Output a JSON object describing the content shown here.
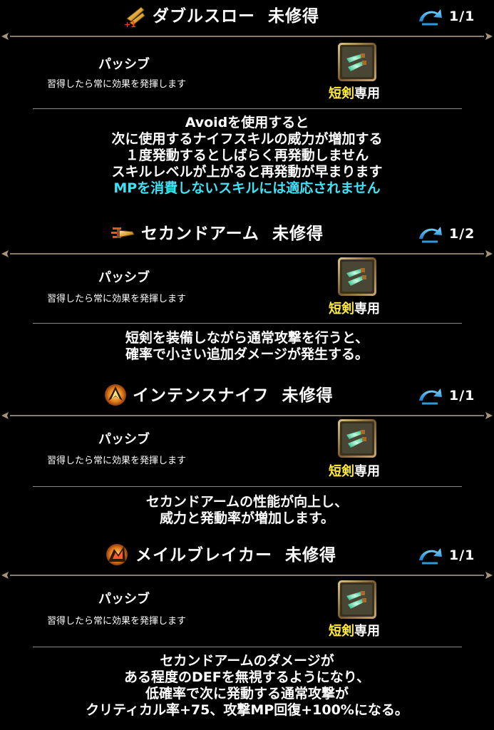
{
  "colors": {
    "background": "#000000",
    "text": "#ffffff",
    "weapon_highlight": "#ffe93a",
    "note_cyan": "#3fe3f6",
    "divider": "#8a7a6a"
  },
  "skills": [
    {
      "icon": "double-throw-icon",
      "name": "ダブルスロー",
      "status": "未修得",
      "level": "1/1",
      "type_label": "パッシブ",
      "type_desc": "習得したら常に効果を発揮します",
      "weapon_prefix": "短剣",
      "weapon_suffix": "専用",
      "desc_lines": [
        "Avoidを使用すると",
        "次に使用するナイフスキルの威力が増加する",
        "１度発動するとしばらく再発動しません",
        "スキルレベルが上がると再発動が早まります"
      ],
      "note": "MPを消費しないスキルには適応されません"
    },
    {
      "icon": "second-arm-icon",
      "name": "セカンドアーム",
      "status": "未修得",
      "level": "1/2",
      "type_label": "パッシブ",
      "type_desc": "習得したら常に効果を発揮します",
      "weapon_prefix": "短剣",
      "weapon_suffix": "専用",
      "desc_lines": [
        "短剣を装備しながら通常攻撃を行うと、",
        "確率で小さい追加ダメージが発生する。"
      ]
    },
    {
      "icon": "intense-knife-icon",
      "name": "インテンスナイフ",
      "status": "未修得",
      "level": "1/1",
      "type_label": "パッシブ",
      "type_desc": "習得したら常に効果を発揮します",
      "weapon_prefix": "短剣",
      "weapon_suffix": "専用",
      "desc_lines": [
        "セカンドアームの性能が向上し、",
        "威力と発動率が増加します。"
      ]
    },
    {
      "icon": "mail-breaker-icon",
      "name": "メイルブレイカー",
      "status": "未修得",
      "level": "1/1",
      "type_label": "パッシブ",
      "type_desc": "習得したら常に効果を発揮します",
      "weapon_prefix": "短剣",
      "weapon_suffix": "専用",
      "desc_lines": [
        "セカンドアームのダメージが",
        "ある程度のDEFを無視するようになり、",
        "低確率で次に発動する通常攻撃が",
        "クリティカル率+75、攻撃MP回復+100%になる。"
      ]
    }
  ]
}
